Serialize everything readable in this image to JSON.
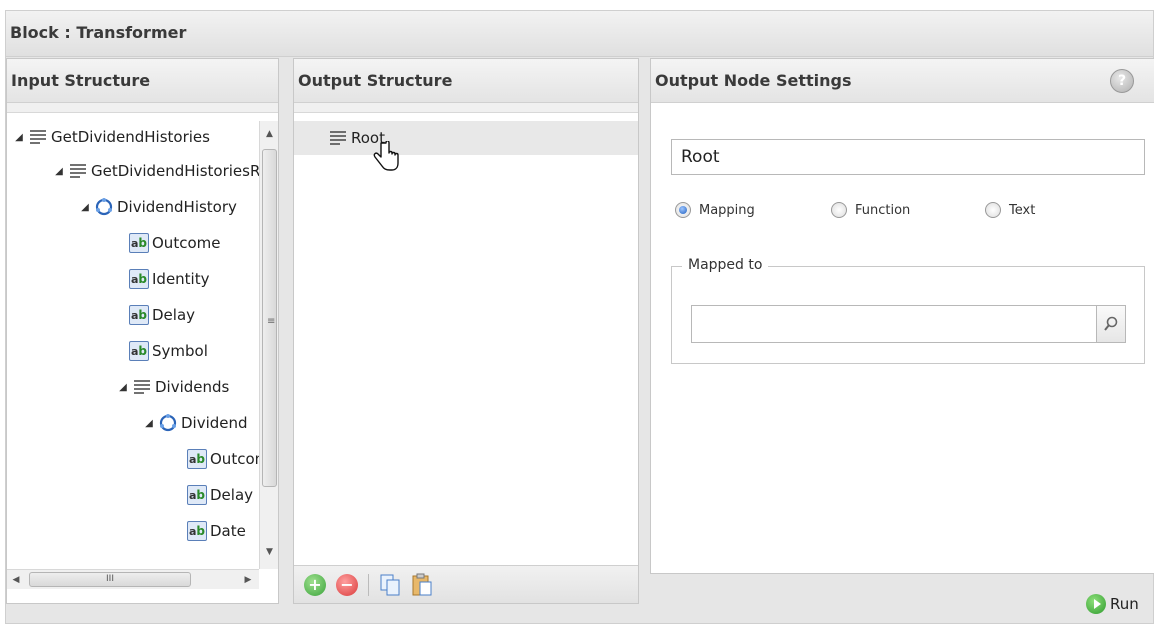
{
  "window": {
    "title": "Block : Transformer"
  },
  "input_panel": {
    "title": "Input Structure",
    "tree": [
      {
        "label": "GetDividendHistories",
        "icon": "list-icon",
        "expanded": true
      },
      {
        "label": "GetDividendHistoriesResult",
        "icon": "list-icon",
        "expanded": true
      },
      {
        "label": "DividendHistory",
        "icon": "cycle-icon",
        "expanded": true
      },
      {
        "label": "Outcome",
        "icon": "attribute-icon"
      },
      {
        "label": "Identity",
        "icon": "attribute-icon"
      },
      {
        "label": "Delay",
        "icon": "attribute-icon"
      },
      {
        "label": "Symbol",
        "icon": "attribute-icon"
      },
      {
        "label": "Dividends",
        "icon": "list-icon",
        "expanded": true
      },
      {
        "label": "Dividend",
        "icon": "cycle-icon",
        "expanded": true
      },
      {
        "label": "Outcome",
        "icon": "attribute-icon"
      },
      {
        "label": "Delay",
        "icon": "attribute-icon"
      },
      {
        "label": "Date",
        "icon": "attribute-icon"
      }
    ]
  },
  "output_panel": {
    "title": "Output Structure",
    "items": [
      {
        "label": "Root",
        "icon": "list-icon",
        "selected": true
      }
    ],
    "toolbar": [
      {
        "name": "add-icon"
      },
      {
        "name": "remove-icon"
      },
      {
        "name": "copy-icon"
      },
      {
        "name": "paste-icon"
      }
    ]
  },
  "settings_panel": {
    "title": "Output Node Settings",
    "node_name": "Root",
    "modes": [
      {
        "label": "Mapping",
        "checked": true
      },
      {
        "label": "Function",
        "checked": false
      },
      {
        "label": "Text",
        "checked": false
      }
    ],
    "mapped_to_label": "Mapped to",
    "mapped_to_value": ""
  },
  "footer": {
    "run_label": "Run"
  },
  "colors": {
    "accent": "#1f5fbf",
    "run_green": "#2e9a2e",
    "remove_red": "#d93a3a"
  }
}
